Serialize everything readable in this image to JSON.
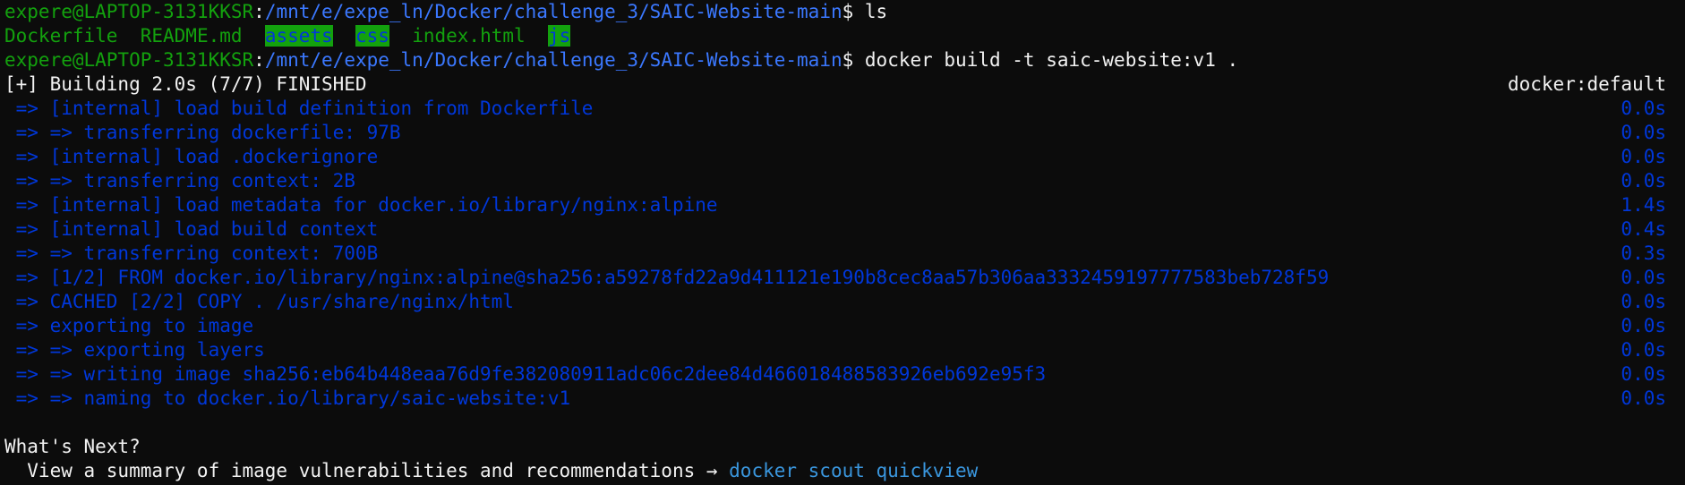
{
  "prompt1": {
    "user_host": "expere@LAPTOP-3131KKSR",
    "sep": ":",
    "path": "/mnt/e/expe_ln/Docker/challenge_3/SAIC-Website-main",
    "dollar": "$ ",
    "command": "ls"
  },
  "ls_output": {
    "dockerfile": "Dockerfile",
    "readme": "README.md",
    "assets": "assets",
    "css": "css",
    "index": "index.html",
    "js": "js"
  },
  "prompt2": {
    "user_host": "expere@LAPTOP-3131KKSR",
    "sep": ":",
    "path": "/mnt/e/expe_ln/Docker/challenge_3/SAIC-Website-main",
    "dollar": "$ ",
    "command": "docker build -t saic-website:v1 ."
  },
  "build_header": {
    "text": "[+] Building 2.0s (7/7) FINISHED",
    "context": "docker:default"
  },
  "steps": [
    {
      "text": " => [internal] load build definition from Dockerfile",
      "time": "0.0s"
    },
    {
      "text": " => => transferring dockerfile: 97B",
      "time": "0.0s"
    },
    {
      "text": " => [internal] load .dockerignore",
      "time": "0.0s"
    },
    {
      "text": " => => transferring context: 2B",
      "time": "0.0s"
    },
    {
      "text": " => [internal] load metadata for docker.io/library/nginx:alpine",
      "time": "1.4s"
    },
    {
      "text": " => [internal] load build context",
      "time": "0.4s"
    },
    {
      "text": " => => transferring context: 700B",
      "time": "0.3s"
    },
    {
      "text": " => [1/2] FROM docker.io/library/nginx:alpine@sha256:a59278fd22a9d411121e190b8cec8aa57b306aa3332459197777583beb728f59",
      "time": "0.0s"
    },
    {
      "text": " => CACHED [2/2] COPY . /usr/share/nginx/html",
      "time": "0.0s"
    },
    {
      "text": " => exporting to image",
      "time": "0.0s"
    },
    {
      "text": " => => exporting layers",
      "time": "0.0s"
    },
    {
      "text": " => => writing image sha256:eb64b448eaa76d9fe382080911adc06c2dee84d466018488583926eb692e95f3",
      "time": "0.0s"
    },
    {
      "text": " => => naming to docker.io/library/saic-website:v1",
      "time": "0.0s"
    }
  ],
  "whats_next": {
    "heading": "What's Next?",
    "hint": "  View a summary of image vulnerabilities and recommendations → ",
    "command": "docker scout quickview"
  }
}
